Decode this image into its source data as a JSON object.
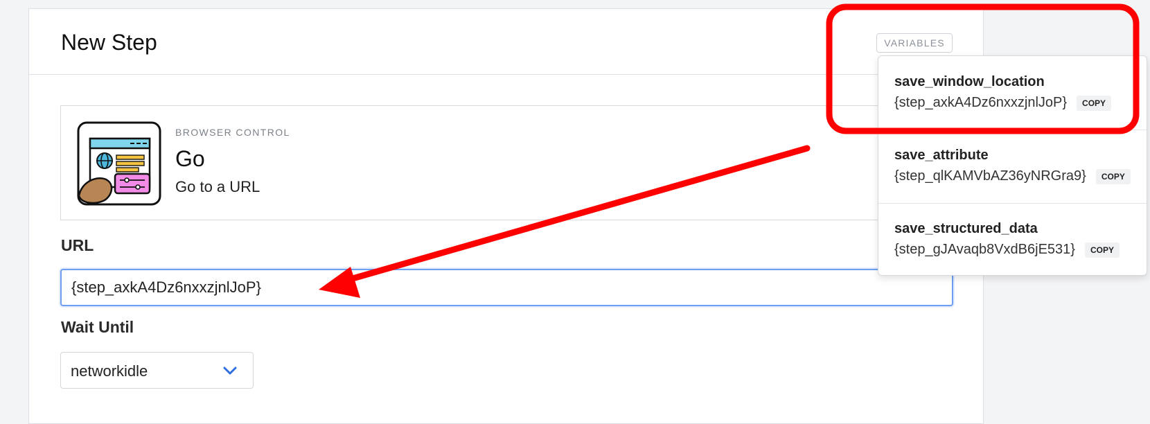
{
  "panel": {
    "title": "New Step",
    "variables_button": "VARIABLES"
  },
  "action": {
    "category": "BROWSER CONTROL",
    "name": "Go",
    "description": "Go to a URL",
    "icon": "browser-window-icon"
  },
  "form": {
    "url_label": "URL",
    "url_value": "{step_axkA4Dz6nxxzjnlJoP}",
    "wait_label": "Wait Until",
    "wait_value": "networkidle",
    "wait_icon": "chevron-down-icon"
  },
  "variables": [
    {
      "name": "save_window_location",
      "value": "{step_axkA4Dz6nxxzjnlJoP}",
      "copy_label": "COPY"
    },
    {
      "name": "save_attribute",
      "value": "{step_qlKAMVbAZ36yNRGra9}",
      "copy_label": "COPY"
    },
    {
      "name": "save_structured_data",
      "value": "{step_gJAvaqb8VxdB6jE531}",
      "copy_label": "COPY"
    }
  ],
  "annotation": {
    "color": "#ff0000"
  }
}
